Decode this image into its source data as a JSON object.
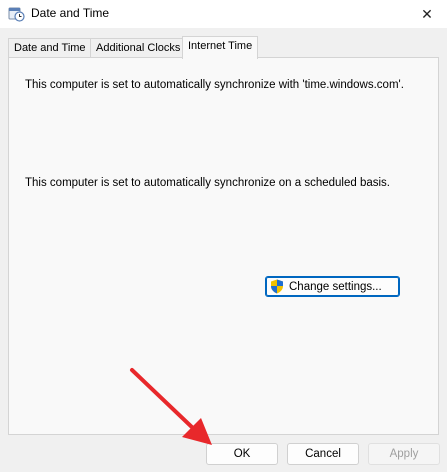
{
  "window": {
    "title": "Date and Time",
    "close_glyph": "✕"
  },
  "tabs": [
    {
      "label": "Date and Time",
      "active": false
    },
    {
      "label": "Additional Clocks",
      "active": false
    },
    {
      "label": "Internet Time",
      "active": true
    }
  ],
  "panel": {
    "sync_server_message": "This computer is set to automatically synchronize with 'time.windows.com'.",
    "schedule_message": "This computer is set to automatically synchronize on a scheduled basis.",
    "change_settings_label": "Change settings..."
  },
  "footer": {
    "ok_label": "OK",
    "cancel_label": "Cancel",
    "apply_label": "Apply"
  },
  "icons": {
    "title": "date-time-icon",
    "change_settings": "uac-shield-icon",
    "close": "close-icon"
  },
  "colors": {
    "accent": "#0067c0",
    "annotation_arrow": "#e8282b"
  }
}
